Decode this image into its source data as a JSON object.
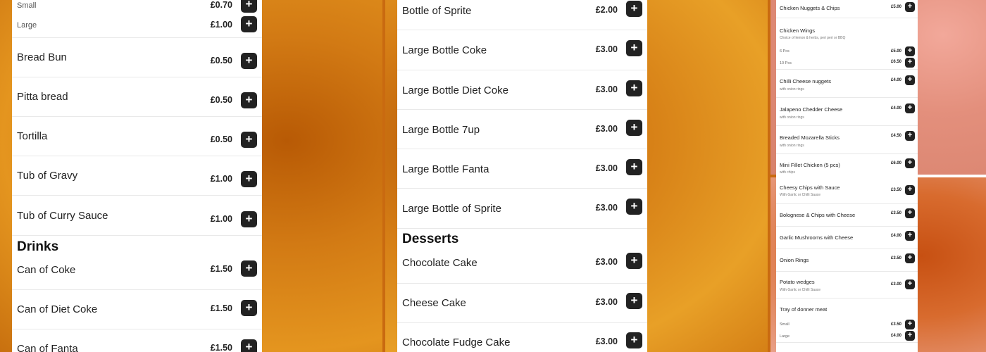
{
  "panel1": {
    "top_rows": [
      {
        "name": "Small",
        "price": "£0.70"
      },
      {
        "name": "Large",
        "price": "£1.00"
      }
    ],
    "rows": [
      {
        "name": "Bread Bun",
        "price": "£0.50"
      },
      {
        "name": "Pitta bread",
        "price": "£0.50"
      },
      {
        "name": "Tortilla",
        "price": "£0.50"
      },
      {
        "name": "Tub of Gravy",
        "price": "£1.00"
      },
      {
        "name": "Tub of Curry Sauce",
        "price": "£1.00"
      }
    ],
    "section": "Drinks",
    "drinks": [
      {
        "name": "Can of Coke",
        "price": "£1.50"
      },
      {
        "name": "Can of Diet Coke",
        "price": "£1.50"
      },
      {
        "name": "Can of Fanta",
        "price": "£1.50"
      }
    ]
  },
  "panel2": {
    "rows": [
      {
        "name": "Bottle of Sprite",
        "price": "£2.00"
      },
      {
        "name": "Large Bottle Coke",
        "price": "£3.00"
      },
      {
        "name": "Large Bottle Diet Coke",
        "price": "£3.00"
      },
      {
        "name": "Large Bottle 7up",
        "price": "£3.00"
      },
      {
        "name": "Large Bottle Fanta",
        "price": "£3.00"
      },
      {
        "name": "Large Bottle of Sprite",
        "price": "£3.00"
      }
    ],
    "section": "Desserts",
    "desserts": [
      {
        "name": "Chocolate Cake",
        "price": "£3.00"
      },
      {
        "name": "Cheese Cake",
        "price": "£3.00"
      },
      {
        "name": "Chocolate Fudge Cake",
        "price": "£3.00"
      }
    ]
  },
  "panel3": {
    "rows": [
      {
        "name": "Chicken Nuggets & Chips",
        "desc": "",
        "price": "£5.00"
      },
      {
        "name": "Chicken Wings",
        "desc": "Choice of lemon & herbs, peri peri or BBQ",
        "price": ""
      },
      {
        "name": "6 Pcs",
        "desc": "",
        "price": "£5.00"
      },
      {
        "name": "10 Pcs",
        "desc": "",
        "price": "£6.50"
      },
      {
        "name": "Chilli Cheese nuggets",
        "desc": "with onion rings",
        "price": "£4.00"
      },
      {
        "name": "Jalapeno Chedder Cheese",
        "desc": "with onion rings",
        "price": "£4.00"
      },
      {
        "name": "Breaded Mozarella Sticks",
        "desc": "with onion rings",
        "price": "£4.50"
      },
      {
        "name": "Mini Fillet Chicken (5 pcs)",
        "desc": "with chips",
        "price": "£6.00"
      },
      {
        "name": "Cheesy Chips with Sauce",
        "desc": "With Garlic or Chilli Sauce",
        "price": "£3.50"
      },
      {
        "name": "Bolognese & Chips with Cheese",
        "desc": "",
        "price": "£3.50"
      },
      {
        "name": "Garlic Mushrooms with Cheese",
        "desc": "",
        "price": "£4.00"
      },
      {
        "name": "Onion Rings",
        "desc": "",
        "price": "£3.50"
      },
      {
        "name": "Potato wedges",
        "desc": "With Garlic or Chilli Sauce",
        "price": "£3.00"
      },
      {
        "name": "Tray of donner meat",
        "desc": "",
        "price": ""
      },
      {
        "name": "Small",
        "desc": "",
        "price": "£3.50"
      },
      {
        "name": "Large",
        "desc": "",
        "price": "£4.00"
      }
    ]
  },
  "add_symbol": "+"
}
